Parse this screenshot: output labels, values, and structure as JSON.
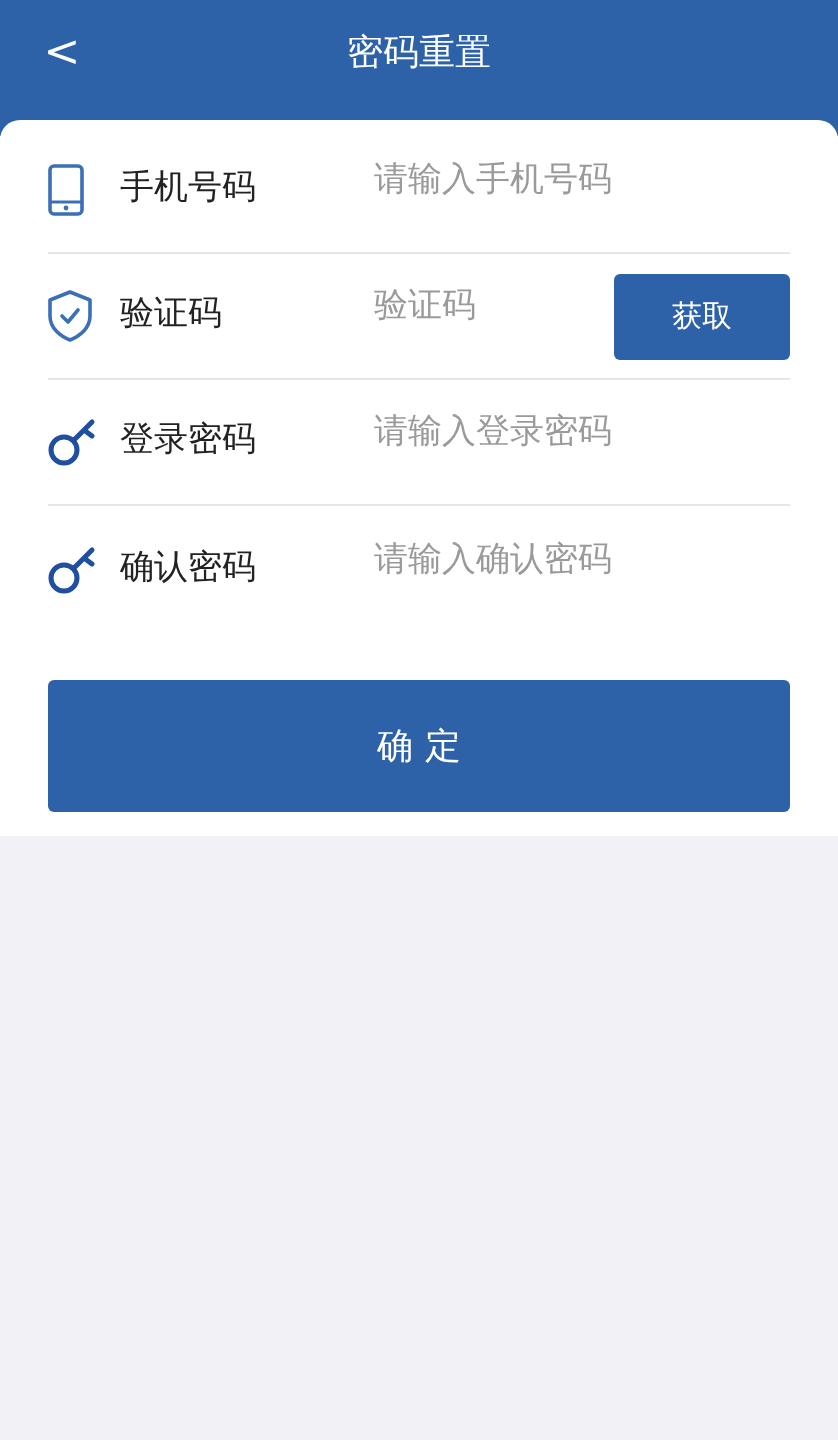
{
  "header": {
    "back": "<",
    "title": "密码重置"
  },
  "fields": [
    {
      "kind": "phone",
      "label": "手机号码",
      "placeholder": "请输入手机号码"
    },
    {
      "kind": "shield",
      "label": "验证码",
      "placeholder": "验证码",
      "button": "获取"
    },
    {
      "kind": "key",
      "label": "登录密码",
      "placeholder": "请输入登录密码"
    },
    {
      "kind": "key",
      "label": "确认密码",
      "placeholder": "请输入确认密码"
    }
  ],
  "submit": "确 定"
}
